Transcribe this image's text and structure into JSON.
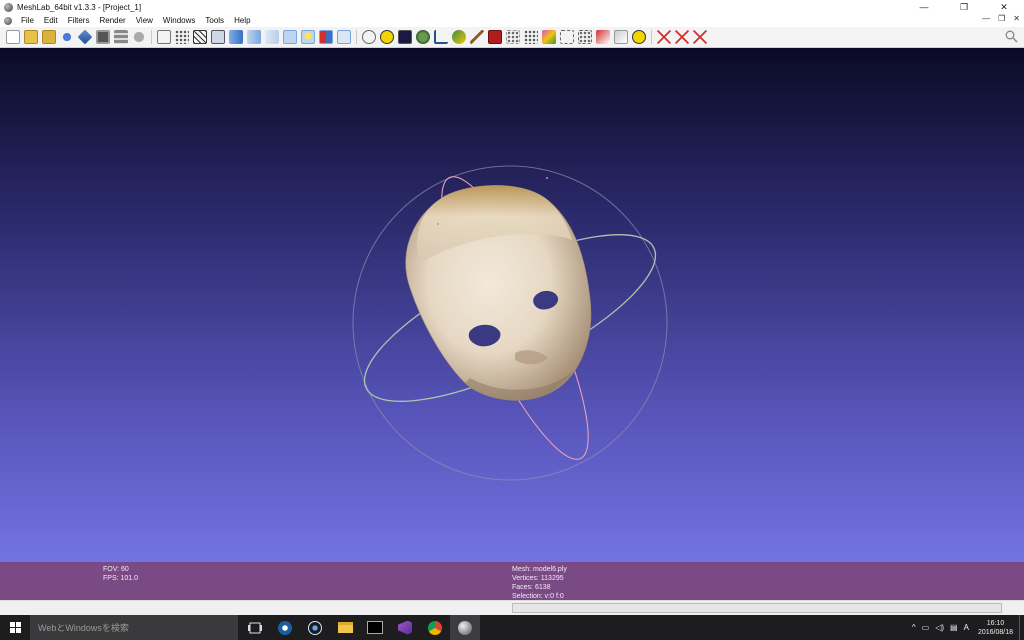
{
  "window": {
    "title": "MeshLab_64bit v1.3.3 - [Project_1]",
    "minimize": "—",
    "restore": "❐",
    "close": "✕"
  },
  "menu": {
    "items": [
      "File",
      "Edit",
      "Filters",
      "Render",
      "View",
      "Windows",
      "Tools",
      "Help"
    ],
    "mdi_minimize": "—",
    "mdi_restore": "❐",
    "mdi_close": "✕"
  },
  "toolbar": {
    "icons": [
      "new-file-icon",
      "open-folder-icon",
      "open-project-icon",
      "reload-icon",
      "import-mesh-icon",
      "snapshot-icon",
      "layers-icon",
      "layer-dialog-icon",
      "bbox-icon",
      "points-icon",
      "wireframe-icon",
      "hidden-lines-icon",
      "flat-shading-icon",
      "flat-lines-icon",
      "smooth-icon",
      "texture-icon",
      "light-icon",
      "two-sided-icon",
      "backface-icon",
      "trackball-icon",
      "annotation-icon",
      "shader-icon",
      "quality-icon",
      "measure-icon",
      "paint-icon",
      "brush-icon",
      "raster-icon",
      "align-icon",
      "select-faces-icon",
      "select-vertices-icon",
      "mesh-select-icon",
      "point-picking-icon",
      "info-icon",
      "delete-faces-icon",
      "delete-vertices-icon",
      "delete-all-icon"
    ],
    "colors": {
      "blue": "#4c7bd6",
      "yellow": "#f1c40f",
      "red": "#d32f2f",
      "green": "#3a8f3a",
      "gray": "#9c9c9c"
    }
  },
  "viewport": {
    "colors": {
      "top": "#0a0a26",
      "bottom": "#7373e3",
      "mesh_light": "#efe4d4",
      "mesh_dark": "#a89178",
      "trackball_ring": "#a9c6b0",
      "axis": "#e8a0b8"
    }
  },
  "info": {
    "fov": "FOV: 60",
    "fps": "FPS:   101.0",
    "mesh": "Mesh: model6.ply",
    "vertices": "Vertices: 113295",
    "faces": "Faces: 6138",
    "selection": "Selection: v:0 f:0"
  },
  "taskbar": {
    "search_placeholder": "WebとWindowsを検索",
    "time": "16:10",
    "date": "2016/08/18",
    "ime": "A"
  }
}
